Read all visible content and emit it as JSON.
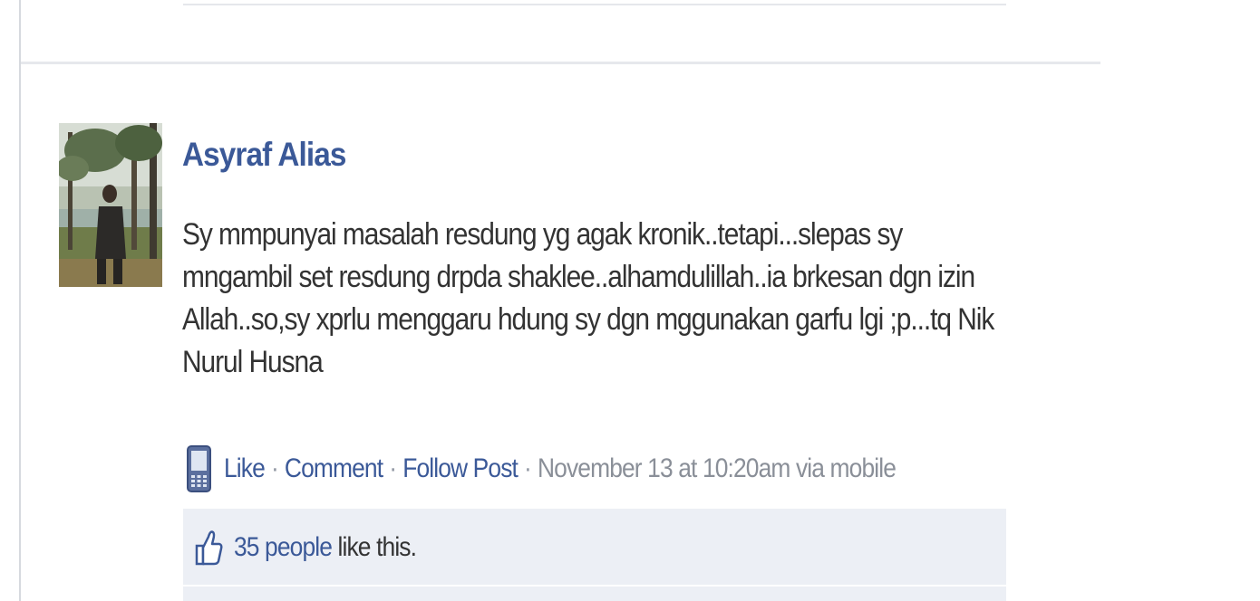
{
  "post": {
    "author": "Asyraf Alias",
    "message_lines": [
      "Sy mmpunyai masalah resdung yg agak kronik..tetapi...slepas sy",
      "mngambil set resdung drpda shaklee..alhamdulillah..ia brkesan dgn izin",
      "Allah..so,sy xprlu menggaru hdung sy dgn mggunakan garfu lgi ;p...tq Nik",
      "Nurul Husna"
    ],
    "actions": {
      "like": "Like",
      "comment": "Comment",
      "follow": "Follow Post",
      "separator": "·",
      "timestamp": "November 13 at 10:20am via mobile"
    },
    "likes": {
      "people": "35 people",
      "suffix": " like this."
    }
  },
  "icons": {
    "source": "mobile-phone-icon",
    "like": "thumbs-up-icon"
  },
  "colors": {
    "link": "#3b5998",
    "text": "#333333",
    "meta": "#8a8f98",
    "likes_bg": "#eceff5"
  }
}
